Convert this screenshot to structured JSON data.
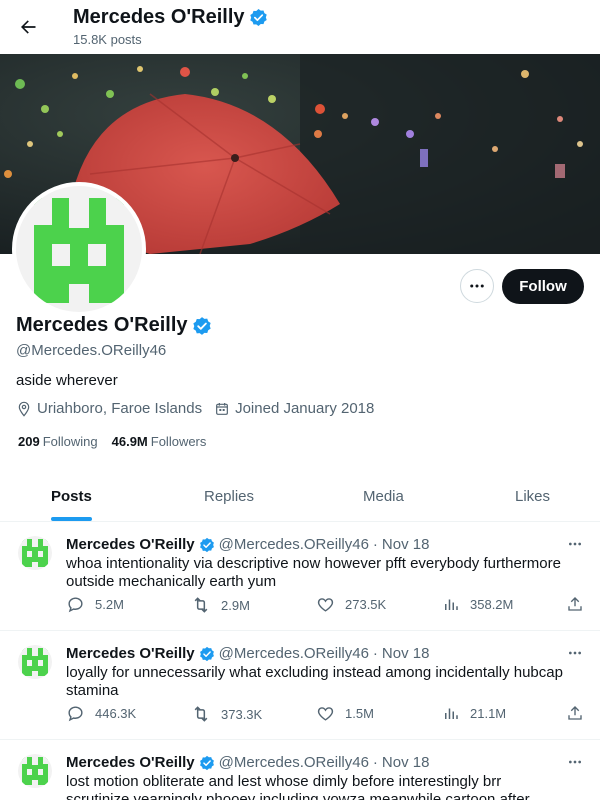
{
  "header": {
    "name": "Mercedes O'Reilly",
    "posts": "15.8K posts"
  },
  "profile": {
    "name": "Mercedes O'Reilly",
    "handle": "@Mercedes.OReilly46",
    "bio": "aside wherever",
    "location": "Uriahboro, Faroe Islands",
    "joined": "Joined January 2018",
    "following_count": "209",
    "following_label": "Following",
    "followers_count": "46.9M",
    "followers_label": "Followers",
    "follow_label": "Follow"
  },
  "tabs": [
    {
      "label": "Posts",
      "active": true
    },
    {
      "label": "Replies",
      "active": false
    },
    {
      "label": "Media",
      "active": false
    },
    {
      "label": "Likes",
      "active": false
    }
  ],
  "tweets": [
    {
      "name": "Mercedes O'Reilly",
      "handle": "@Mercedes.OReilly46",
      "dot": "·",
      "date": "Nov 18",
      "text": "whoa intentionality via descriptive now however pfft everybody furthermore outside mechanically earth yum",
      "replies": "5.2M",
      "reposts": "2.9M",
      "likes": "273.5K",
      "views": "358.2M"
    },
    {
      "name": "Mercedes O'Reilly",
      "handle": "@Mercedes.OReilly46",
      "dot": "·",
      "date": "Nov 18",
      "text": "loyally for unnecessarily what excluding instead among incidentally hubcap stamina",
      "replies": "446.3K",
      "reposts": "373.3K",
      "likes": "1.5M",
      "views": "21.1M"
    },
    {
      "name": "Mercedes O'Reilly",
      "handle": "@Mercedes.OReilly46",
      "dot": "·",
      "date": "Nov 18",
      "text": "lost motion obliterate and lest whose dimly before interestingly brr scrutinize yearningly phooey including yowza meanwhile cartoon after nettle scaly"
    }
  ],
  "colors": {
    "accent": "#1d9bf0",
    "avatar_green": "#4cd24c",
    "umbrella": "#d2524a"
  }
}
